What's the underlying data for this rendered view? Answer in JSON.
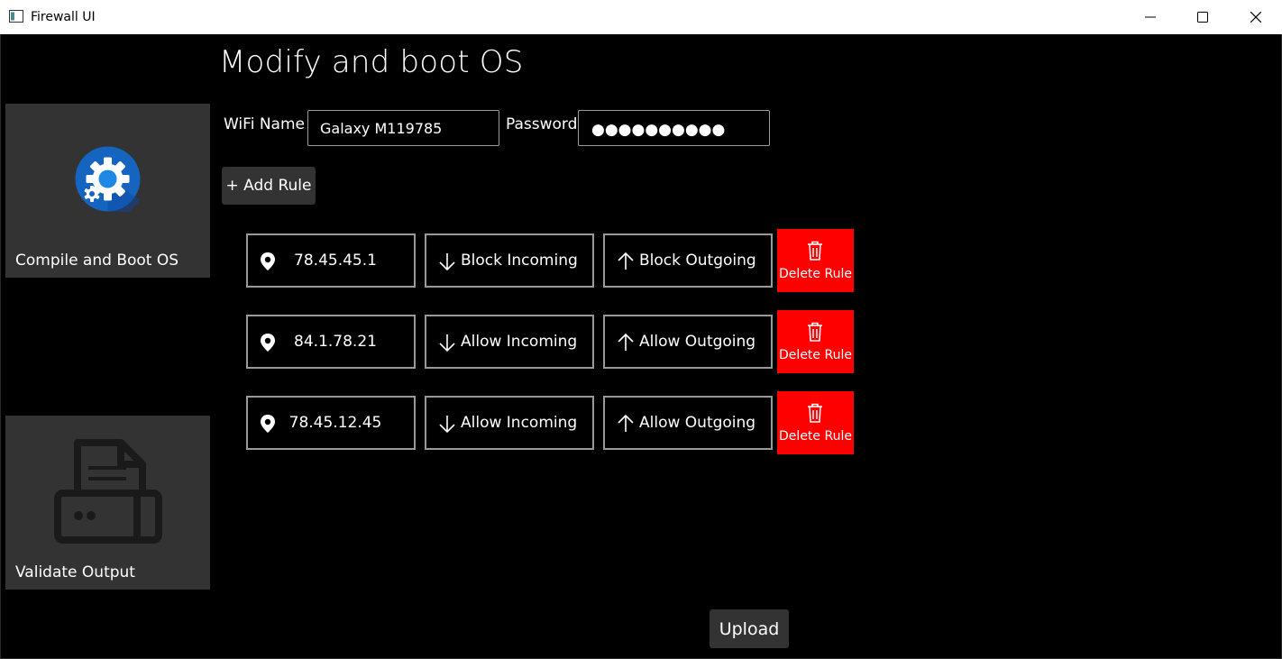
{
  "window": {
    "title": "Firewall UI"
  },
  "page": {
    "title": "Modify and boot OS"
  },
  "sidebar": {
    "items": [
      {
        "label": "Compile and Boot OS",
        "icon": "settings-gear-icon"
      },
      {
        "label": "Validate Output",
        "icon": "printer-icon"
      }
    ]
  },
  "wifi": {
    "name_label": "WiFi Name",
    "name_value": "Galaxy M119785",
    "password_label": "Password",
    "password_mask": "●●●●●●●●●●"
  },
  "toolbar": {
    "add_rule_label": "+ Add Rule"
  },
  "rules": [
    {
      "ip": "78.45.45.1",
      "incoming": "Block Incoming",
      "outgoing": "Block Outgoing",
      "delete_label": "Delete Rule"
    },
    {
      "ip": "84.1.78.21",
      "incoming": "Allow Incoming",
      "outgoing": "Allow Outgoing",
      "delete_label": "Delete Rule"
    },
    {
      "ip": "78.45.12.45",
      "incoming": "Allow Incoming",
      "outgoing": "Allow Outgoing",
      "delete_label": "Delete Rule"
    }
  ],
  "footer": {
    "upload_label": "Upload"
  },
  "colors": {
    "background": "#000000",
    "tile": "#333333",
    "delete": "#ff0000",
    "accent_blue": "#1565c0"
  }
}
